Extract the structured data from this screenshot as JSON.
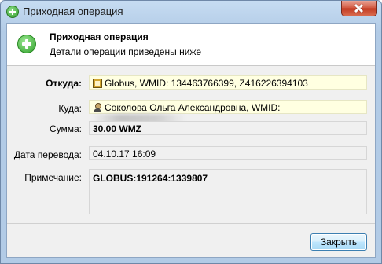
{
  "window": {
    "title": "Приходная операция"
  },
  "header": {
    "title": "Приходная операция",
    "subtitle": "Детали операции приведены ниже"
  },
  "fields": {
    "from": {
      "label": "Откуда:",
      "value": "Globus, WMID: 134463766399, Z416226394103",
      "icon": "id-card-icon"
    },
    "to": {
      "label": "Куда:",
      "value": "Соколова Ольга Александровна, WMID:",
      "icon": "person-icon"
    },
    "amount": {
      "label": "Сумма:",
      "value": "30.00 WMZ"
    },
    "date": {
      "label": "Дата перевода:",
      "value": "04.10.17 16:09"
    },
    "note": {
      "label": "Примечание:",
      "value": "GLOBUS:191264:1339807"
    }
  },
  "buttons": {
    "close": "Закрыть"
  },
  "colors": {
    "accent": "#3c7fb1",
    "highlight_field": "#ffffe1",
    "add_icon": "#2f9f2a",
    "close_button": "#c23a22"
  }
}
